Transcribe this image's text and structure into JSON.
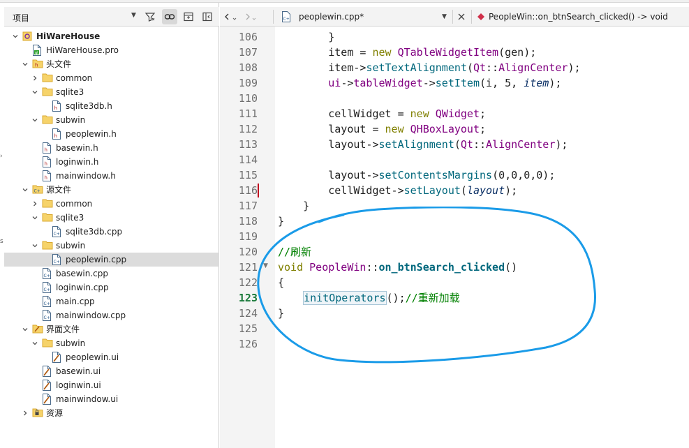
{
  "project_panel": {
    "title": "项目",
    "tree": [
      {
        "label": "HiWareHouse",
        "level": 0,
        "expand": "open",
        "icon": "qt-project-icon",
        "bold": true
      },
      {
        "label": "HiWareHouse.pro",
        "level": 1,
        "expand": "none",
        "icon": "pro-file-icon"
      },
      {
        "label": "头文件",
        "level": 1,
        "expand": "open",
        "icon": "header-folder-icon"
      },
      {
        "label": "common",
        "level": 2,
        "expand": "closed",
        "icon": "folder-icon"
      },
      {
        "label": "sqlite3",
        "level": 2,
        "expand": "open",
        "icon": "folder-icon"
      },
      {
        "label": "sqlite3db.h",
        "level": 3,
        "expand": "none",
        "icon": "h-file-icon"
      },
      {
        "label": "subwin",
        "level": 2,
        "expand": "open",
        "icon": "folder-icon"
      },
      {
        "label": "peoplewin.h",
        "level": 3,
        "expand": "none",
        "icon": "h-file-icon"
      },
      {
        "label": "basewin.h",
        "level": 2,
        "expand": "none",
        "icon": "h-file-icon"
      },
      {
        "label": "loginwin.h",
        "level": 2,
        "expand": "none",
        "icon": "h-file-icon"
      },
      {
        "label": "mainwindow.h",
        "level": 2,
        "expand": "none",
        "icon": "h-file-icon"
      },
      {
        "label": "源文件",
        "level": 1,
        "expand": "open",
        "icon": "source-folder-icon"
      },
      {
        "label": "common",
        "level": 2,
        "expand": "closed",
        "icon": "folder-icon"
      },
      {
        "label": "sqlite3",
        "level": 2,
        "expand": "open",
        "icon": "folder-icon"
      },
      {
        "label": "sqlite3db.cpp",
        "level": 3,
        "expand": "none",
        "icon": "cpp-file-icon"
      },
      {
        "label": "subwin",
        "level": 2,
        "expand": "open",
        "icon": "folder-icon"
      },
      {
        "label": "peoplewin.cpp",
        "level": 3,
        "expand": "none",
        "icon": "cpp-file-icon",
        "selected": true
      },
      {
        "label": "basewin.cpp",
        "level": 2,
        "expand": "none",
        "icon": "cpp-file-icon"
      },
      {
        "label": "loginwin.cpp",
        "level": 2,
        "expand": "none",
        "icon": "cpp-file-icon"
      },
      {
        "label": "main.cpp",
        "level": 2,
        "expand": "none",
        "icon": "cpp-file-icon"
      },
      {
        "label": "mainwindow.cpp",
        "level": 2,
        "expand": "none",
        "icon": "cpp-file-icon"
      },
      {
        "label": "界面文件",
        "level": 1,
        "expand": "open",
        "icon": "form-folder-icon"
      },
      {
        "label": "subwin",
        "level": 2,
        "expand": "open",
        "icon": "folder-icon"
      },
      {
        "label": "peoplewin.ui",
        "level": 3,
        "expand": "none",
        "icon": "ui-file-icon"
      },
      {
        "label": "basewin.ui",
        "level": 2,
        "expand": "none",
        "icon": "ui-file-icon"
      },
      {
        "label": "loginwin.ui",
        "level": 2,
        "expand": "none",
        "icon": "ui-file-icon"
      },
      {
        "label": "mainwindow.ui",
        "level": 2,
        "expand": "none",
        "icon": "ui-file-icon"
      },
      {
        "label": "资源",
        "level": 1,
        "expand": "closed",
        "icon": "resource-folder-icon"
      }
    ]
  },
  "editor": {
    "tab_filename": "peoplewin.cpp*",
    "symbol": "PeopleWin::on_btnSearch_clicked() -> void",
    "current_line": 123,
    "modified_line": 116,
    "fold_line": 121,
    "lines": [
      {
        "n": 106,
        "tokens": [
          [
            "        }",
            ""
          ]
        ]
      },
      {
        "n": 107,
        "tokens": [
          [
            "        item = ",
            ""
          ],
          [
            "new",
            "kw"
          ],
          [
            " ",
            ""
          ],
          [
            "QTableWidgetItem",
            "ty"
          ],
          [
            "(gen);",
            ""
          ]
        ]
      },
      {
        "n": 108,
        "tokens": [
          [
            "        item->",
            ""
          ],
          [
            "setTextAlignment",
            "fn"
          ],
          [
            "(",
            ""
          ],
          [
            "Qt",
            "ty"
          ],
          [
            "::",
            ""
          ],
          [
            "AlignCenter",
            "ty"
          ],
          [
            ");",
            ""
          ]
        ]
      },
      {
        "n": 109,
        "tokens": [
          [
            "        ",
            ""
          ],
          [
            "ui",
            "ty"
          ],
          [
            "->",
            ""
          ],
          [
            "tableWidget",
            "ty"
          ],
          [
            "->",
            ""
          ],
          [
            "setItem",
            "fn"
          ],
          [
            "(i, 5, ",
            ""
          ],
          [
            "item",
            "it"
          ],
          [
            ");",
            ""
          ]
        ]
      },
      {
        "n": 110,
        "tokens": []
      },
      {
        "n": 111,
        "tokens": [
          [
            "        cellWidget = ",
            ""
          ],
          [
            "new",
            "kw"
          ],
          [
            " ",
            ""
          ],
          [
            "QWidget",
            "ty"
          ],
          [
            ";",
            ""
          ]
        ]
      },
      {
        "n": 112,
        "tokens": [
          [
            "        layout = ",
            ""
          ],
          [
            "new",
            "kw"
          ],
          [
            " ",
            ""
          ],
          [
            "QHBoxLayout",
            "ty"
          ],
          [
            ";",
            ""
          ]
        ]
      },
      {
        "n": 113,
        "tokens": [
          [
            "        layout->",
            ""
          ],
          [
            "setAlignment",
            "fn"
          ],
          [
            "(",
            ""
          ],
          [
            "Qt",
            "ty"
          ],
          [
            "::",
            ""
          ],
          [
            "AlignCenter",
            "ty"
          ],
          [
            ");",
            ""
          ]
        ]
      },
      {
        "n": 114,
        "tokens": []
      },
      {
        "n": 115,
        "tokens": [
          [
            "        layout->",
            ""
          ],
          [
            "setContentsMargins",
            "fn"
          ],
          [
            "(0,0,0,0);",
            ""
          ]
        ]
      },
      {
        "n": 116,
        "tokens": [
          [
            "        cellWidget->",
            ""
          ],
          [
            "setLayout",
            "fn"
          ],
          [
            "(",
            ""
          ],
          [
            "layout",
            "it"
          ],
          [
            ");",
            ""
          ]
        ]
      },
      {
        "n": 117,
        "tokens": [
          [
            "    }",
            ""
          ]
        ]
      },
      {
        "n": 118,
        "tokens": [
          [
            "}",
            ""
          ]
        ]
      },
      {
        "n": 119,
        "tokens": []
      },
      {
        "n": 120,
        "tokens": [
          [
            "//刷新",
            "cm"
          ]
        ]
      },
      {
        "n": 121,
        "tokens": [
          [
            "void",
            "kw"
          ],
          [
            " ",
            ""
          ],
          [
            "PeopleWin",
            "ty"
          ],
          [
            "::",
            ""
          ],
          [
            "on_btnSearch_clicked",
            "fnb"
          ],
          [
            "()",
            ""
          ]
        ]
      },
      {
        "n": 122,
        "tokens": [
          [
            "{",
            ""
          ]
        ]
      },
      {
        "n": 123,
        "tokens": [
          [
            "    ",
            ""
          ],
          [
            "initOperators",
            "hl-fn"
          ],
          [
            "();",
            ""
          ],
          [
            "//重新加载",
            "cm"
          ]
        ]
      },
      {
        "n": 124,
        "tokens": [
          [
            "}",
            ""
          ]
        ]
      },
      {
        "n": 125,
        "tokens": []
      },
      {
        "n": 126,
        "tokens": []
      }
    ]
  },
  "colors": {
    "annotation": "#1a9be8",
    "keyword": "#808000",
    "type": "#800080",
    "function": "#00677c",
    "comment": "#008000",
    "modified_marker": "#c0001e"
  }
}
